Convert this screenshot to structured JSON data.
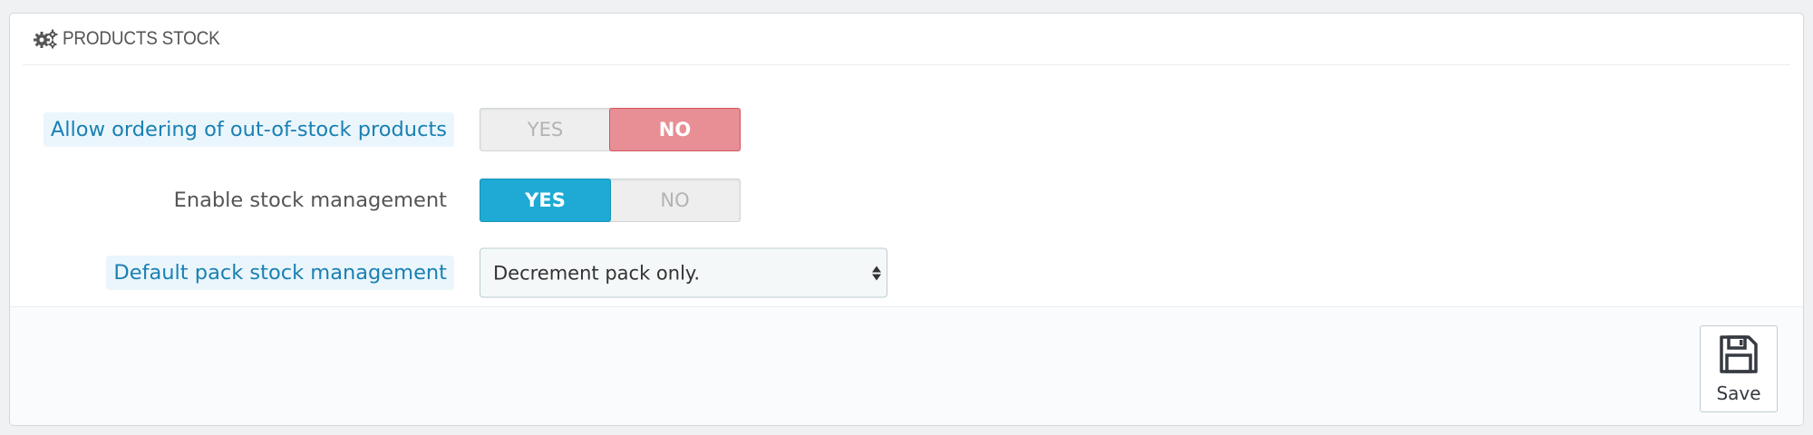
{
  "panel": {
    "title": "Products stock",
    "icon": "gears-icon"
  },
  "fields": {
    "allow_ordering": {
      "label": "Allow ordering of out-of-stock products",
      "yes_label": "YES",
      "no_label": "NO",
      "selected": "no"
    },
    "stock_management": {
      "label": "Enable stock management",
      "yes_label": "YES",
      "no_label": "NO",
      "selected": "yes"
    },
    "pack_stock": {
      "label": "Default pack stock management",
      "value": "Decrement pack only."
    }
  },
  "footer": {
    "save_label": "Save",
    "save_icon": "floppy-disk-icon"
  },
  "colors": {
    "no_active": "#e78f94",
    "yes_active": "#1eaad5",
    "help_label": "#1a80b3"
  }
}
